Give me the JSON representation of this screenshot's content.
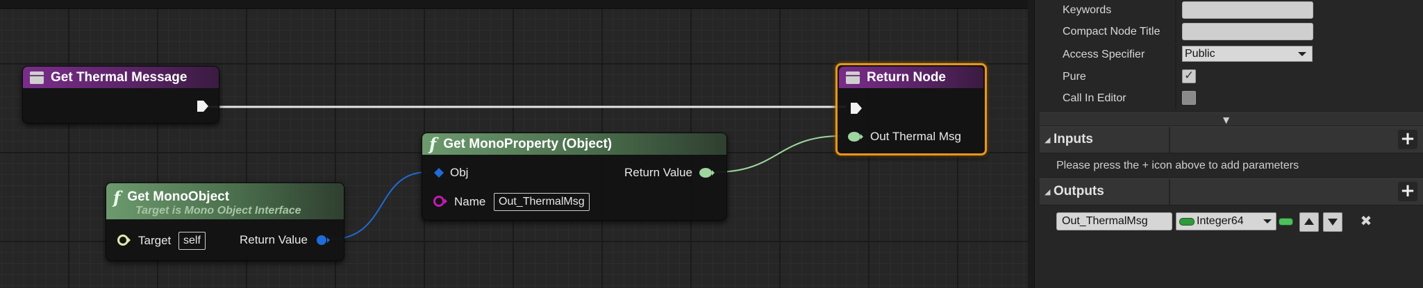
{
  "graph": {
    "nodes": {
      "get_thermal_message": {
        "title": "Get Thermal Message"
      },
      "get_mono_object": {
        "title": "Get MonoObject",
        "subtitle": "Target is Mono Object Interface",
        "pin_target_label": "Target",
        "pin_target_value": "self",
        "pin_return_label": "Return Value"
      },
      "get_mono_property": {
        "title": "Get MonoProperty (Object)",
        "pin_obj_label": "Obj",
        "pin_return_label": "Return Value",
        "pin_name_label": "Name",
        "pin_name_value": "Out_ThermalMsg"
      },
      "return_node": {
        "title": "Return Node",
        "pin_out_label": "Out Thermal Msg"
      }
    },
    "colors": {
      "function_header": "#4a6e4c",
      "event_header": "#5a2466",
      "selection_outline": "#e8961c",
      "object_pin": "#1f6cd6",
      "name_pin": "#c21bb0",
      "integer64_pin": "#6fd18a"
    }
  },
  "details": {
    "rows": {
      "keywords": {
        "label": "Keywords",
        "value": ""
      },
      "compact_title": {
        "label": "Compact Node Title",
        "value": ""
      },
      "access": {
        "label": "Access Specifier",
        "value": "Public"
      },
      "pure": {
        "label": "Pure",
        "checked": true
      },
      "call_in_editor": {
        "label": "Call In Editor",
        "checked": false
      }
    },
    "inputs": {
      "title": "Inputs",
      "hint": "Please press the + icon above to add parameters"
    },
    "outputs": {
      "title": "Outputs",
      "param_name": "Out_ThermalMsg",
      "param_type": "Integer64"
    },
    "icons": {
      "add": "plus-icon",
      "move_up": "arrow-up-icon",
      "move_down": "arrow-down-icon",
      "remove": "close-icon",
      "expand": "chevron-down-icon"
    }
  }
}
